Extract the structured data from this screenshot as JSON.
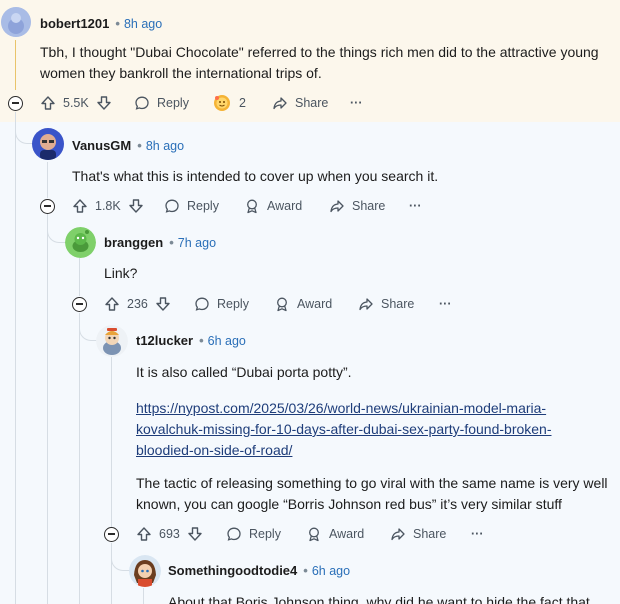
{
  "comments": [
    {
      "username": "bobert1201",
      "time": "8h ago",
      "body": "Tbh, I thought \"Dubai Chocolate\" referred to the things rich men did to the attractive young women they bankroll the international trips of.",
      "upvotes": "5.5K",
      "reply_label": "Reply",
      "award_count": "2",
      "share_label": "Share",
      "more_label": "···"
    },
    {
      "username": "VanusGM",
      "time": "8h ago",
      "body": "That's what this is intended to cover up when you search it.",
      "upvotes": "1.8K",
      "reply_label": "Reply",
      "award_label": "Award",
      "share_label": "Share",
      "more_label": "···"
    },
    {
      "username": "branggen",
      "time": "7h ago",
      "body": "Link?",
      "upvotes": "236",
      "reply_label": "Reply",
      "award_label": "Award",
      "share_label": "Share",
      "more_label": "···"
    },
    {
      "username": "t12lucker",
      "time": "6h ago",
      "body": "It is also called “Dubai porta potty”.",
      "link_lines": [
        "https://nypost.com/2025/03/26/world-news/ukrainian-model-maria-",
        "kovalchuk-missing-for-10-days-after-dubai-sex-party-found-broken-",
        "bloodied-on-side-of-road/"
      ],
      "body2_lines": [
        "The tactic of releasing something to go viral with the same name is very well",
        "known, you can google “Borris Johnson red bus” it’s very similar stuff"
      ],
      "upvotes": "693",
      "reply_label": "Reply",
      "award_label": "Award",
      "share_label": "Share",
      "more_label": "···"
    },
    {
      "username": "Somethingoodtodie4",
      "time": "6h ago",
      "body": "About that Boris Johnson thing, why did he want to hide the fact that"
    }
  ],
  "colors": {
    "highlight_bg": "#fcf7ec",
    "page_bg": "#f5f9fd",
    "time_color": "#2a6fb8",
    "thread_line": "#d6dde4",
    "highlight_line": "#e9c46a"
  }
}
